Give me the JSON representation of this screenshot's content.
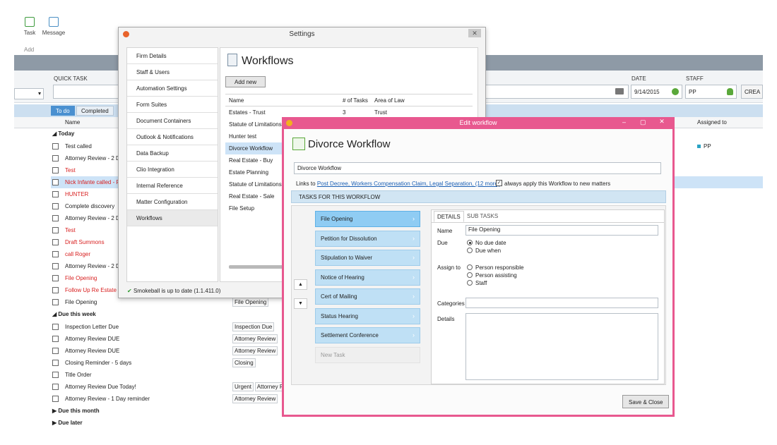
{
  "ribbon": {
    "task_label": "Task",
    "message_label": "Message",
    "group_label": "Add"
  },
  "quick_task": {
    "label": "QUICK TASK",
    "date_label": "DATE",
    "date_value": "9/14/2015",
    "staff_label": "STAFF",
    "staff_value": "PP",
    "create_label": "CREA"
  },
  "tabs": [
    "To do",
    "Completed"
  ],
  "columns": {
    "name": "Name",
    "assigned": "Assigned to"
  },
  "groups": {
    "today": "Today",
    "week": "Due this week",
    "month": "Due this month",
    "later": "Due later"
  },
  "tasks_today": [
    {
      "name": "Test called",
      "red": false
    },
    {
      "name": "Attorney Review - 2 D",
      "red": false
    },
    {
      "name": "Test",
      "red": true
    },
    {
      "name": "Nick Infante called - F",
      "red": true
    },
    {
      "name": "HUNTER",
      "red": true
    },
    {
      "name": "Complete discovery",
      "red": false
    },
    {
      "name": "Attorney Review - 2 D",
      "red": false
    },
    {
      "name": "Test",
      "red": true
    },
    {
      "name": "Draft Summons",
      "red": true
    },
    {
      "name": "call Roger",
      "red": true
    },
    {
      "name": "Attorney Review - 2 D",
      "red": false
    },
    {
      "name": "File Opening",
      "red": true
    },
    {
      "name": "Follow Up Re Estate C",
      "red": true
    },
    {
      "name": "File Opening",
      "red": false
    }
  ],
  "tag_file_opening": "File Opening",
  "assigned_pp": "PP",
  "tasks_week": [
    {
      "name": "Inspection Letter Due",
      "tags": [
        "Inspection Due"
      ]
    },
    {
      "name": "Attorney Review DUE",
      "tags": [
        "Attorney Review"
      ]
    },
    {
      "name": "Attorney Review DUE",
      "tags": [
        "Attorney Review"
      ]
    },
    {
      "name": "Closing Reminder - 5 days",
      "tags": [
        "Closing"
      ]
    },
    {
      "name": "Title Order",
      "tags": []
    },
    {
      "name": "Attorney Review Due Today!",
      "tags": [
        "Urgent",
        "Attorney R"
      ]
    },
    {
      "name": "Attorney Review - 1 Day reminder",
      "tags": [
        "Attorney Review"
      ]
    }
  ],
  "settings": {
    "title": "Settings",
    "nav": [
      "Firm Details",
      "Staff & Users",
      "Automation Settings",
      "Form Suites",
      "Document Containers",
      "Outlook & Notifications",
      "Data Backup",
      "Clio Integration",
      "Internal Reference",
      "Matter Configuration",
      "Workflows"
    ],
    "heading": "Workflows",
    "add_new": "Add new",
    "table_headers": [
      "Name",
      "# of Tasks",
      "Area of Law"
    ],
    "workflows": [
      {
        "name": "Estates - Trust",
        "tasks": "3",
        "area": "Trust"
      },
      {
        "name": "Statute of Limitations",
        "tasks": "",
        "area": ""
      },
      {
        "name": "Hunter test",
        "tasks": "",
        "area": ""
      },
      {
        "name": "Divorce Workflow",
        "tasks": "",
        "area": ""
      },
      {
        "name": "Real Estate - Buy",
        "tasks": "",
        "area": ""
      },
      {
        "name": "Estate Planning",
        "tasks": "",
        "area": ""
      },
      {
        "name": "Statute of Limitations",
        "tasks": "",
        "area": ""
      },
      {
        "name": "Real Estate - Sale",
        "tasks": "",
        "area": ""
      },
      {
        "name": "File Setup",
        "tasks": "",
        "area": ""
      }
    ],
    "status": "Smokeball is up to date (1.1.411.0)"
  },
  "edit": {
    "title": "Edit workflow",
    "heading": "Divorce Workflow",
    "name_value": "Divorce Workflow",
    "links_prefix": "Links to",
    "links_value": "Post Decree, Workers Compensation Claim, Legal Separation, (12 more)",
    "always_apply": "always apply this Workflow to new matters",
    "section_title": "TASKS FOR THIS WORKFLOW",
    "tasks": [
      "File Opening",
      "Petition for Dissolution",
      "Stipulation to Waiver",
      "Notice of Hearing",
      "Cert of Mailing",
      "Status Hearing",
      "Settlement Conference"
    ],
    "new_task": "New Task",
    "detail_tabs": [
      "DETAILS",
      "SUB TASKS"
    ],
    "name_label": "Name",
    "name_field": "File Opening",
    "due_label": "Due",
    "due_options": [
      "No due date",
      "Due when"
    ],
    "assign_label": "Assign to",
    "assign_options": [
      "Person responsible",
      "Person assisting",
      "Staff"
    ],
    "categories_label": "Categories",
    "details_label": "Details",
    "save_close": "Save & Close"
  }
}
